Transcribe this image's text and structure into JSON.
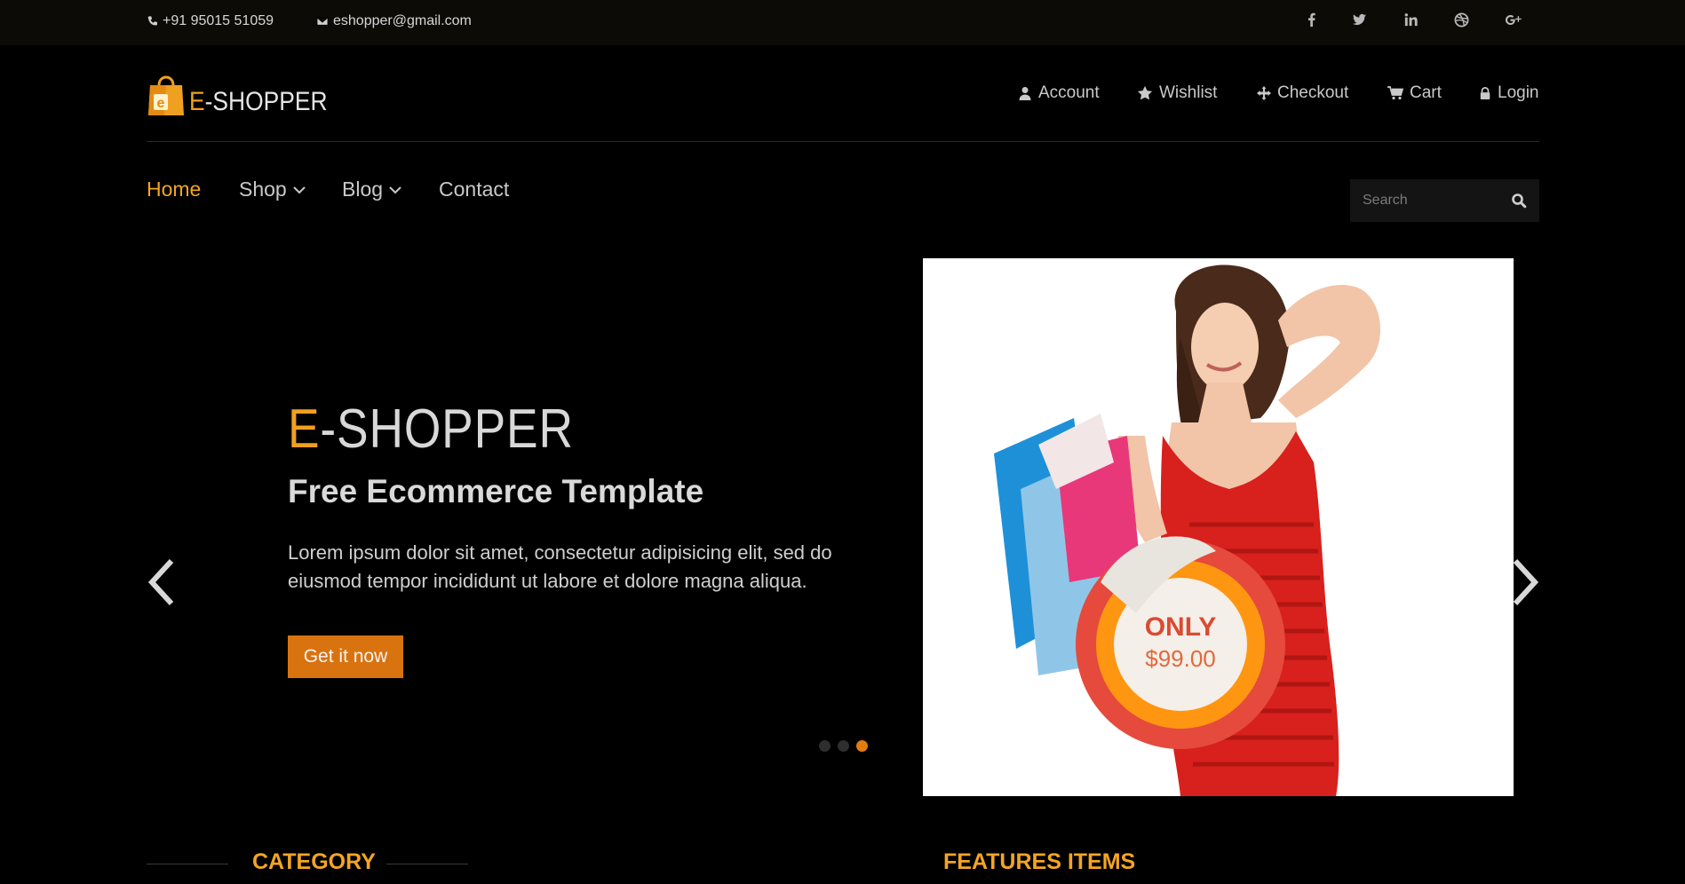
{
  "topbar": {
    "phone": "+91 95015 51059",
    "email": "eshopper@gmail.com",
    "social": [
      "facebook-icon",
      "twitter-icon",
      "linkedin-icon",
      "dribbble-icon",
      "google-plus-icon"
    ]
  },
  "logo": {
    "prefix": "E",
    "rest": "-SHOPPER",
    "bag_letter": "e"
  },
  "usernav": {
    "account": "Account",
    "wishlist": "Wishlist",
    "checkout": "Checkout",
    "cart": "Cart",
    "login": "Login"
  },
  "mainnav": {
    "home": "Home",
    "shop": "Shop",
    "blog": "Blog",
    "contact": "Contact"
  },
  "search": {
    "placeholder": "Search"
  },
  "slider": {
    "title_accent": "E",
    "title_rest": "-SHOPPER",
    "subtitle": "Free Ecommerce Template",
    "description": "Lorem ipsum dolor sit amet, consectetur adipisicing elit, sed do eiusmod tempor incididunt ut labore et dolore magna aliqua.",
    "button": "Get it now",
    "badge_line1": "ONLY",
    "badge_line2": "$99.00",
    "active_slide": 3,
    "slide_count": 3
  },
  "sections": {
    "category": "CATEGORY",
    "features": "FEATURES ITEMS"
  },
  "colors": {
    "accent": "#f4a524",
    "button": "#d9730f",
    "background": "#000000",
    "topbar": "#0c0b06"
  }
}
